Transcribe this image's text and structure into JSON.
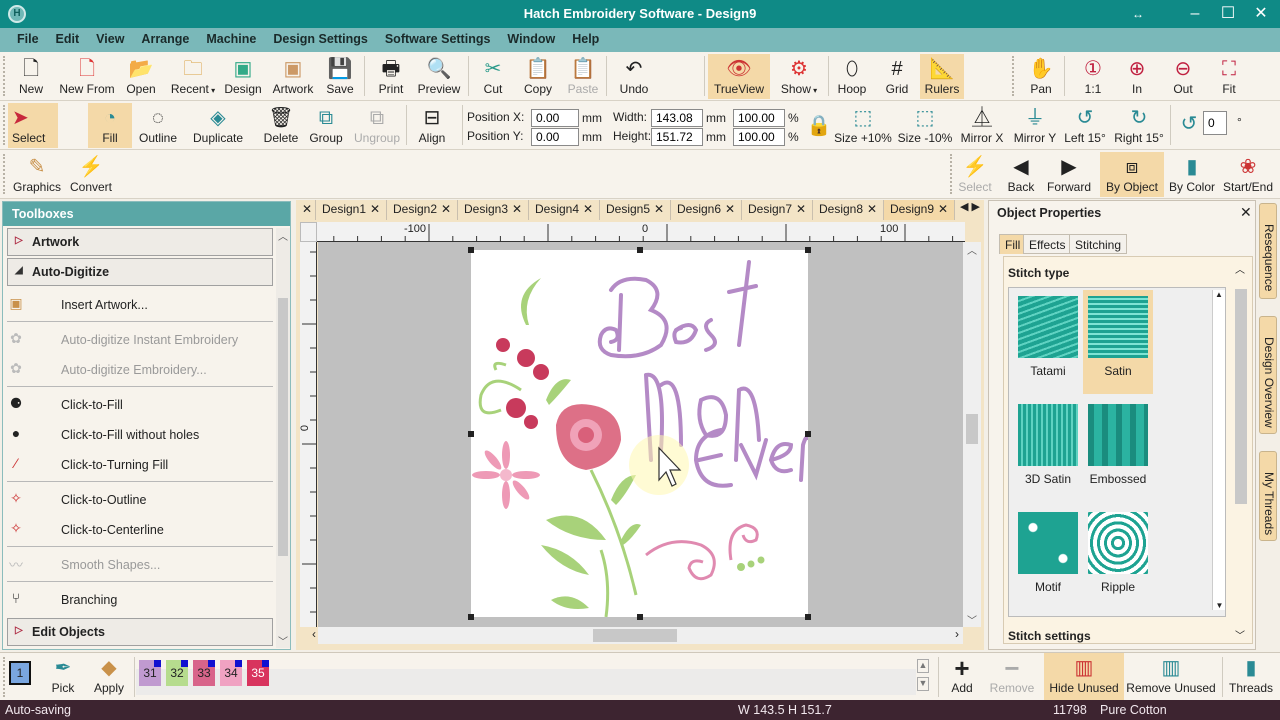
{
  "window": {
    "title": "Hatch Embroidery Software - Design9",
    "app_icon": "hatch-logo-icon",
    "controls": {
      "resize": "↔",
      "minimize": "–",
      "maximize": "☐",
      "close": "✕"
    }
  },
  "menu": [
    "File",
    "Edit",
    "View",
    "Arrange",
    "Machine",
    "Design Settings",
    "Software Settings",
    "Window",
    "Help"
  ],
  "toolbar1": {
    "file": [
      {
        "label": "New",
        "icon": "new-document-icon"
      },
      {
        "label": "New From",
        "icon": "new-from-template-icon"
      },
      {
        "label": "Open",
        "icon": "open-folder-icon"
      },
      {
        "label": "Recent",
        "icon": "recent-folder-icon",
        "dropdown": true
      },
      {
        "label": "Design",
        "icon": "insert-design-icon"
      },
      {
        "label": "Artwork",
        "icon": "insert-artwork-icon"
      },
      {
        "label": "Save",
        "icon": "save-disk-icon"
      }
    ],
    "print": [
      {
        "label": "Print",
        "icon": "printer-icon"
      },
      {
        "label": "Preview",
        "icon": "print-preview-icon"
      }
    ],
    "edit": [
      {
        "label": "Cut",
        "icon": "cut-icon"
      },
      {
        "label": "Copy",
        "icon": "copy-icon"
      },
      {
        "label": "Paste",
        "icon": "paste-icon",
        "disabled": true
      },
      {
        "label": "Undo",
        "icon": "undo-icon"
      }
    ],
    "view": [
      {
        "label": "TrueView",
        "icon": "trueview-eye-icon",
        "active": true
      },
      {
        "label": "Show",
        "icon": "show-settings-icon",
        "dropdown": true
      },
      {
        "label": "Hoop",
        "icon": "hoop-icon"
      },
      {
        "label": "Grid",
        "icon": "grid-icon"
      },
      {
        "label": "Rulers",
        "icon": "rulers-icon",
        "active": true
      }
    ],
    "zoom": [
      {
        "label": "Pan",
        "icon": "pan-hand-icon"
      },
      {
        "label": "1:1",
        "icon": "zoom-actual-icon"
      },
      {
        "label": "In",
        "icon": "zoom-in-icon"
      },
      {
        "label": "Out",
        "icon": "zoom-out-icon"
      },
      {
        "label": "Fit",
        "icon": "zoom-fit-icon"
      }
    ]
  },
  "toolbar2": {
    "select": {
      "label": "Select",
      "icon": "select-arrow-icon",
      "active": true
    },
    "tools": [
      {
        "label": "Fill",
        "icon": "fill-shape-icon",
        "active": true
      },
      {
        "label": "Outline",
        "icon": "outline-shape-icon"
      },
      {
        "label": "Duplicate",
        "icon": "duplicate-layers-icon",
        "dropdown": true
      },
      {
        "label": "Delete",
        "icon": "trash-icon"
      },
      {
        "label": "Group",
        "icon": "group-icon"
      },
      {
        "label": "Ungroup",
        "icon": "ungroup-icon",
        "disabled": true
      },
      {
        "label": "Align",
        "icon": "align-icon",
        "dropdown": true
      }
    ],
    "position": {
      "x_label": "Position X:",
      "x_value": "0.00",
      "y_label": "Position Y:",
      "y_value": "0.00",
      "unit": "mm"
    },
    "size": {
      "width_label": "Width:",
      "width_value": "143.08",
      "height_label": "Height:",
      "height_value": "151.72",
      "unit": "mm",
      "width_pct": "100.00",
      "height_pct": "100.00",
      "pct_unit": "%"
    },
    "transform": [
      {
        "label": "Size +10%",
        "icon": "size-up-icon"
      },
      {
        "label": "Size -10%",
        "icon": "size-down-icon"
      },
      {
        "label": "Mirror X",
        "icon": "mirror-x-icon"
      },
      {
        "label": "Mirror Y",
        "icon": "mirror-y-icon"
      },
      {
        "label": "Left 15°",
        "icon": "rotate-left-icon"
      },
      {
        "label": "Right 15°",
        "icon": "rotate-right-icon"
      }
    ],
    "rotate_value": "0",
    "rotate_unit": "°"
  },
  "toolbar3": {
    "left": [
      {
        "label": "Graphics",
        "icon": "pencil-icon"
      },
      {
        "label": "Convert",
        "icon": "convert-icon"
      }
    ],
    "right": [
      {
        "label": "Select",
        "icon": "stitch-select-icon",
        "disabled": true
      },
      {
        "label": "Back",
        "icon": "back-triangle-icon"
      },
      {
        "label": "Forward",
        "icon": "forward-triangle-icon"
      },
      {
        "label": "By Object",
        "icon": "by-object-icon",
        "active": true
      },
      {
        "label": "By Color",
        "icon": "by-color-icon"
      },
      {
        "label": "Start/End",
        "icon": "start-end-icon"
      }
    ]
  },
  "toolboxes": {
    "title": "Toolboxes",
    "sections": [
      {
        "label": "Artwork",
        "expanded": false
      },
      {
        "label": "Auto-Digitize",
        "expanded": true
      },
      {
        "label": "Edit Objects",
        "expanded": false
      }
    ],
    "items": [
      {
        "label": "Insert Artwork...",
        "icon": "insert-artwork-icon"
      },
      {
        "label": "Auto-digitize Instant Embroidery",
        "icon": "auto-digitize-instant-icon",
        "disabled": true
      },
      {
        "label": "Auto-digitize Embroidery...",
        "icon": "auto-digitize-icon",
        "disabled": true
      },
      {
        "label": "Click-to-Fill",
        "icon": "click-to-fill-icon"
      },
      {
        "label": "Click-to-Fill without holes",
        "icon": "click-to-fill-no-holes-icon"
      },
      {
        "label": "Click-to-Turning Fill",
        "icon": "click-to-turning-fill-icon"
      },
      {
        "label": "Click-to-Outline",
        "icon": "click-to-outline-icon"
      },
      {
        "label": "Click-to-Centerline",
        "icon": "click-to-centerline-icon"
      },
      {
        "label": "Smooth Shapes...",
        "icon": "smooth-shapes-icon",
        "disabled": true
      },
      {
        "label": "Branching",
        "icon": "branching-icon"
      }
    ]
  },
  "design_tabs": {
    "tabs": [
      "Design1",
      "Design2",
      "Design3",
      "Design4",
      "Design5",
      "Design6",
      "Design7",
      "Design8",
      "Design9"
    ],
    "active": "Design9",
    "close_glyph": "✕"
  },
  "rulers": {
    "top_labels": [
      "-100",
      "0",
      "100"
    ],
    "left_labels": [
      "0"
    ]
  },
  "design": {
    "text_lines": [
      "Best",
      "Mom",
      "Ever"
    ],
    "colors": {
      "lettering": "#b48ac6",
      "rose": "#d9607a",
      "leaf": "#a8d27a",
      "petal": "#ee9ab6",
      "dark_rose": "#c83a5c"
    }
  },
  "object_properties": {
    "title": "Object Properties",
    "tabs": [
      "Fill",
      "Effects",
      "Stitching"
    ],
    "active_tab": "Fill",
    "stitch_type_heading": "Stitch type",
    "stitch_types": [
      {
        "label": "Tatami",
        "selected": false
      },
      {
        "label": "Satin",
        "selected": true
      },
      {
        "label": "3D Satin",
        "selected": false
      },
      {
        "label": "Embossed",
        "selected": false
      },
      {
        "label": "Motif",
        "selected": false
      },
      {
        "label": "Ripple",
        "selected": false
      }
    ],
    "stitch_settings_heading": "Stitch settings"
  },
  "side_tabs": [
    {
      "label": "Resequence",
      "icon": "resequence-icon"
    },
    {
      "label": "Design Overview",
      "icon": "design-overview-icon"
    },
    {
      "label": "My Threads",
      "icon": "thread-spool-icon"
    }
  ],
  "color_bar": {
    "current": "1",
    "current_color": "#7aa6e0",
    "pick_label": "Pick",
    "apply_label": "Apply",
    "chips": [
      {
        "num": "31",
        "color": "#c09ad0"
      },
      {
        "num": "32",
        "color": "#b6dc8e"
      },
      {
        "num": "33",
        "color": "#d8648a"
      },
      {
        "num": "34",
        "color": "#f0a2c2"
      },
      {
        "num": "35",
        "color": "#d8345e"
      }
    ],
    "actions": [
      {
        "label": "Add",
        "icon": "plus-icon"
      },
      {
        "label": "Remove",
        "icon": "minus-icon",
        "disabled": true
      },
      {
        "label": "Hide Unused",
        "icon": "hide-unused-icon",
        "active": true
      },
      {
        "label": "Remove Unused",
        "icon": "remove-unused-icon"
      },
      {
        "label": "Threads",
        "icon": "thread-spool-icon"
      }
    ]
  },
  "status": {
    "message": "Auto-saving",
    "dimensions": "W 143.5 H 151.7",
    "stitch_count": "11798",
    "thread": "Pure Cotton"
  }
}
